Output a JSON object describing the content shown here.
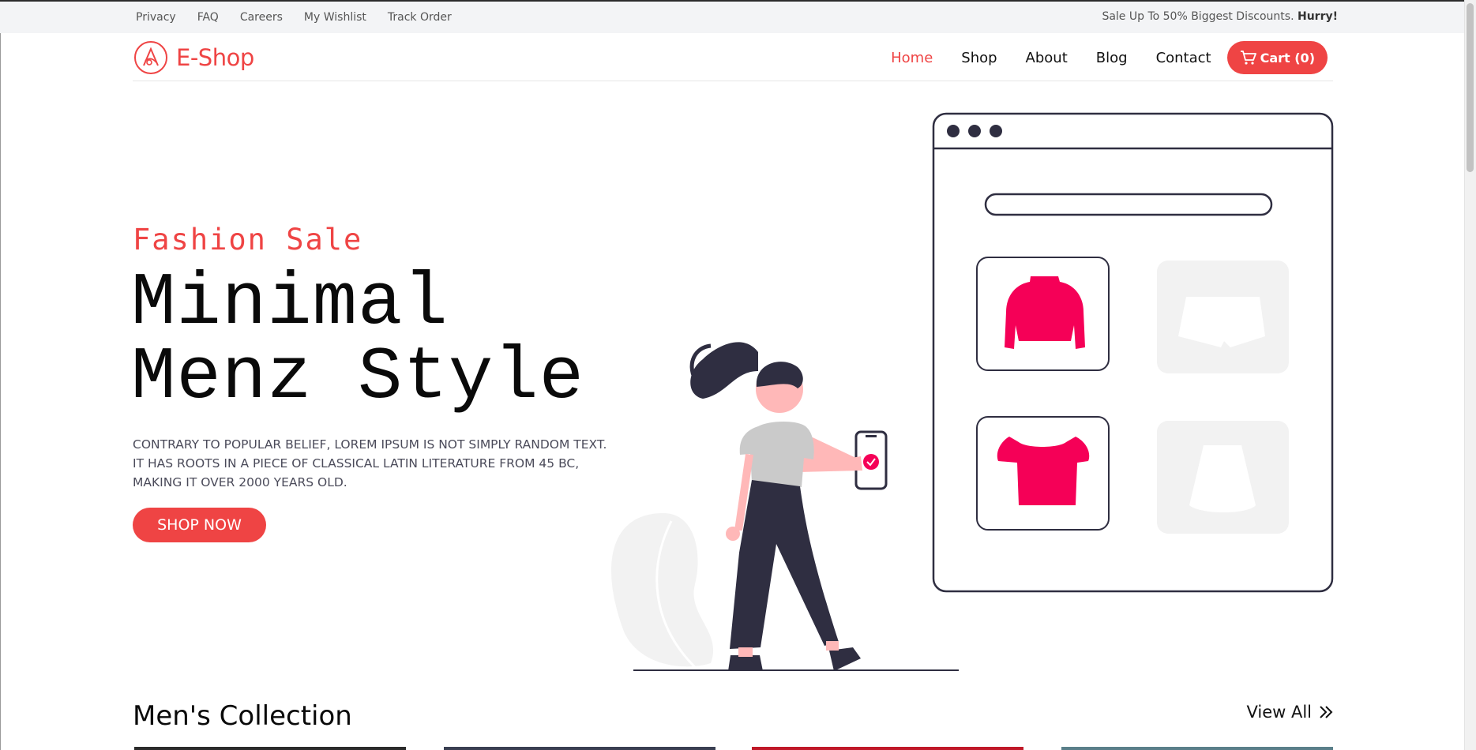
{
  "topbar": {
    "links": [
      "Privacy",
      "FAQ",
      "Careers",
      "My Wishlist",
      "Track Order"
    ],
    "promo_text": "Sale Up To 50% Biggest Discounts.",
    "promo_emphasis": "Hurry!"
  },
  "brand": {
    "name_prefix": "E-",
    "name_suffix": "Shop",
    "accent_color": "#ef4444"
  },
  "nav": {
    "items": [
      "Home",
      "Shop",
      "About",
      "Blog",
      "Contact"
    ],
    "active": "Home",
    "cart_label": "Cart (0)"
  },
  "hero": {
    "subtitle": "Fashion Sale",
    "title_line1": "Minimal",
    "title_line2": "Menz Style",
    "description_line1": "CONTRARY TO POPULAR BELIEF, LOREM IPSUM IS NOT SIMPLY RANDOM TEXT.",
    "description_line2": "IT HAS ROOTS IN A PIECE OF CLASSICAL LATIN LITERATURE FROM 45 BC,",
    "description_line3": "MAKING IT OVER 2000 YEARS OLD.",
    "cta_label": "SHOP NOW"
  },
  "collection": {
    "title": "Men's Collection",
    "view_all_label": "View All"
  },
  "icons": [
    "logo-mark-icon",
    "cart-icon",
    "double-chevron-right-icon",
    "sweater-icon",
    "shorts-icon",
    "crop-top-icon",
    "skirt-icon",
    "phone-check-icon"
  ],
  "colors": {
    "accent": "#ef4444",
    "illustration_pink": "#f50057",
    "illustration_dark": "#2f2e41",
    "illustration_gray": "#f2f2f2"
  }
}
